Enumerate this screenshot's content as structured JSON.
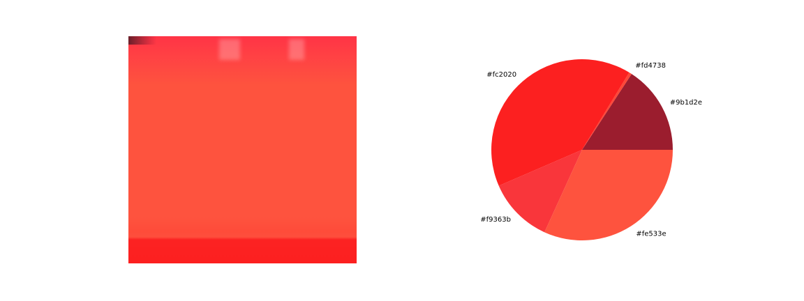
{
  "image_panel": {
    "colors": {
      "dominant": "#fe533e",
      "top_band": "#fd4738",
      "bottom_band": "#fc2020",
      "corner": "#6b1f2a"
    }
  },
  "chart_data": {
    "type": "pie",
    "title": "",
    "slices": [
      {
        "label": "#9b1d2e",
        "color": "#9b1d2e",
        "value": 15.8
      },
      {
        "label": "#fd4738",
        "color": "#fd4738",
        "value": 0.5
      },
      {
        "label": "#fc2020",
        "color": "#fc2020",
        "value": 40.2
      },
      {
        "label": "#f9363b",
        "color": "#f9363b",
        "value": 11.7
      },
      {
        "label": "#fe533e",
        "color": "#fe533e",
        "value": 31.8
      }
    ],
    "start_angle_deg": 0,
    "direction": "counterclockwise",
    "legend": "none"
  }
}
